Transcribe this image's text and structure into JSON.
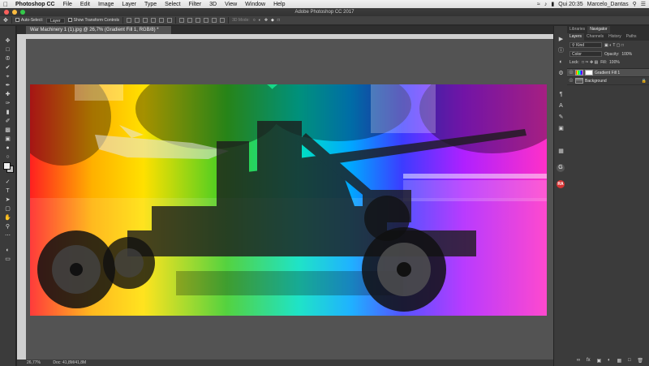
{
  "menubar": {
    "app_name": "Photoshop CC",
    "items": [
      "File",
      "Edit",
      "Image",
      "Layer",
      "Type",
      "Select",
      "Filter",
      "3D",
      "View",
      "Window",
      "Help"
    ],
    "clock": "Qui 20:35",
    "user": "Marcelo_Dantas"
  },
  "window": {
    "title": "Adobe Photoshop CC 2017"
  },
  "options_bar": {
    "auto_select_label": "Auto-Select:",
    "auto_select_value": "Layer",
    "transform_controls_label": "Show Transform Controls",
    "mode_label": "3D Mode:"
  },
  "document": {
    "tab_title": "War Machinery 1 (1).jpg @ 26,7% (Gradient Fill 1, RGB/8) *",
    "zoom": "26,77%",
    "doc_size": "Doc: 41,8M/41,8M"
  },
  "panels": {
    "top_tabs": [
      "Libraries",
      "Navigator"
    ],
    "layer_tabs": [
      "Layers",
      "Channels",
      "History",
      "Paths"
    ],
    "filter_kind": "Kind",
    "blend_mode": "Color",
    "opacity_label": "Opacity:",
    "opacity_value": "100%",
    "lock_label": "Lock:",
    "fill_label": "Fill:",
    "fill_value": "100%",
    "layers": [
      {
        "name": "Gradient Fill 1",
        "selected": true
      },
      {
        "name": "Background",
        "locked": true
      }
    ]
  },
  "dock_icons": [
    "play-icon",
    "info-icon",
    "adjustments-icon",
    "paragraph-icon",
    "character-icon",
    "brush-icon",
    "glyph-icon",
    "libraries-G-icon",
    "avatar-RA"
  ],
  "colors": {
    "foreground": "#f0f0f0",
    "background": "#bdbdbd",
    "avatar": "#d63434"
  }
}
